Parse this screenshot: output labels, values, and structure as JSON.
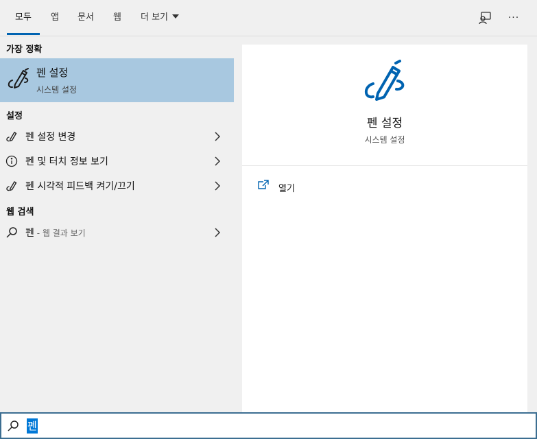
{
  "tabs": [
    {
      "label": "모두"
    },
    {
      "label": "앱"
    },
    {
      "label": "문서"
    },
    {
      "label": "웹"
    },
    {
      "label": "더 보기"
    }
  ],
  "top_icons": [
    "feedback-icon",
    "more-icon"
  ],
  "more_label": "···",
  "best_match": {
    "section_title": "가장 정확",
    "title": "펜 설정",
    "subtitle": "시스템 설정",
    "icon": "pen-icon"
  },
  "settings": {
    "section_title": "설정",
    "items": [
      {
        "label": "펜 설정 변경",
        "icon": "pen-icon"
      },
      {
        "label": "펜 및 터치 정보 보기",
        "icon": "info-icon"
      },
      {
        "label": "펜 시각적 피드백 켜기/끄기",
        "icon": "pen-icon"
      }
    ]
  },
  "web": {
    "section_title": "웹 검색",
    "items": [
      {
        "label": "펜",
        "sub": " - 웹 결과 보기",
        "icon": "search-icon"
      }
    ]
  },
  "detail": {
    "title": "펜 설정",
    "subtitle": "시스템 설정",
    "icon": "pen-icon",
    "actions": [
      {
        "label": "열기",
        "icon": "open-icon"
      }
    ]
  },
  "search": {
    "value": "펜",
    "icon": "search-icon"
  },
  "colors": {
    "accent": "#0063b1",
    "selected_bg": "#a8c8e0",
    "icon_blue": "#0063b1"
  }
}
